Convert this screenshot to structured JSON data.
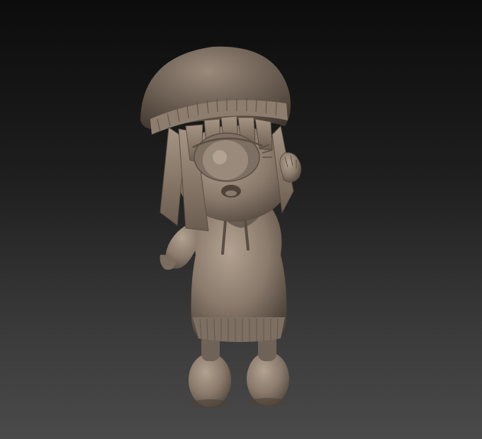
{
  "viewport": {
    "background_top": "#0c0c0c",
    "background_bottom": "#4a4a4a"
  },
  "model": {
    "material_color": "#8a7a6c",
    "shadow_color": "#4e4339",
    "highlight_color": "#b3a291",
    "parts": [
      "beanie",
      "hair-fringe",
      "single-eye",
      "open-mouth",
      "hoodie-dress",
      "raised-hand",
      "left-arm",
      "legs",
      "boots"
    ]
  }
}
